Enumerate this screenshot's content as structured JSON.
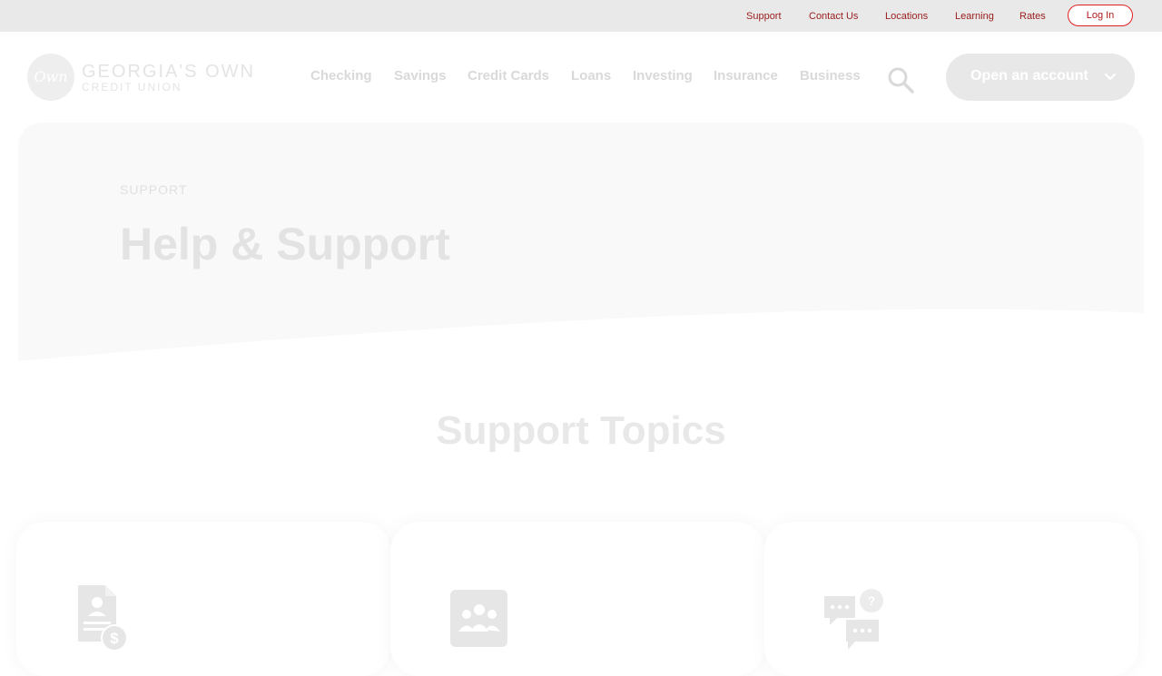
{
  "utility_nav": {
    "links": [
      "Support",
      "Contact Us",
      "Locations",
      "Learning",
      "Rates"
    ],
    "login_label": "Log In"
  },
  "brand": {
    "logo_mark": "Own",
    "name": "GEORGIA'S OWN",
    "subname": "CREDIT UNION"
  },
  "main_nav": {
    "items": [
      "Checking",
      "Savings",
      "Credit Cards",
      "Loans",
      "Investing",
      "Insurance",
      "Business"
    ],
    "search_icon": "search-icon",
    "cta_label": "Open an account",
    "cta_icon": "chevron-down-icon"
  },
  "hero": {
    "eyebrow": "SUPPORT",
    "title": "Help & Support"
  },
  "topics": {
    "title": "Support Topics",
    "cards": [
      {
        "icon": "document-dollar-icon"
      },
      {
        "icon": "people-icon"
      },
      {
        "icon": "chat-question-icon"
      }
    ]
  },
  "colors": {
    "utility_bar": "#e9e9e9",
    "accent_red": "#e02020",
    "hero_bg": "#f9f9f9",
    "faded_text": "#e3e3e3"
  }
}
